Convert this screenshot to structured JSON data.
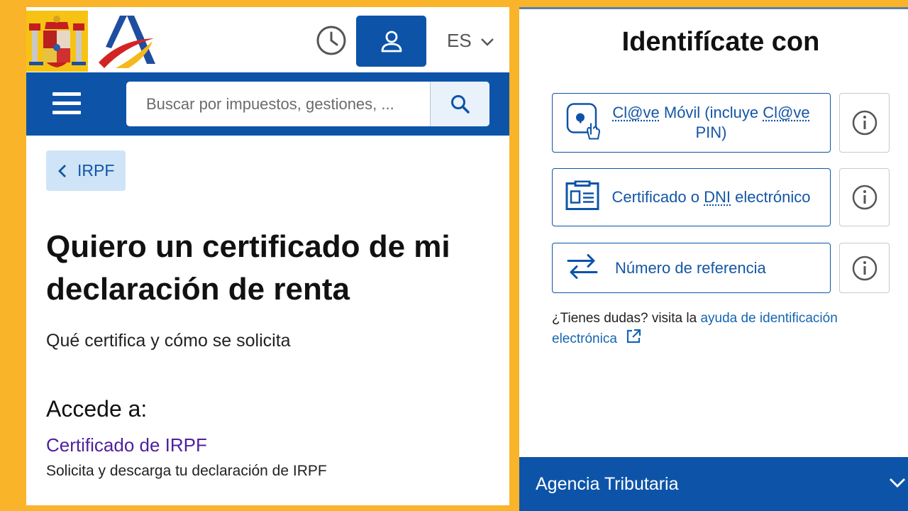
{
  "header": {
    "lang": "ES",
    "search_placeholder": "Buscar por impuestos, gestiones, ..."
  },
  "left": {
    "back_label": "IRPF",
    "title": "Quiero un certificado de mi declaración de renta",
    "subtitle": "Qué certifica y cómo se solicita",
    "accede": "Accede a:",
    "cert_link": "Certificado de IRPF",
    "cert_desc": "Solicita y descarga tu declaración de IRPF"
  },
  "right": {
    "title": "Identifícate con",
    "options": [
      {
        "label_a": "Cl@ve",
        "label_b": " Móvil (incluye ",
        "label_c": "Cl@ve",
        "label_d": " PIN)"
      },
      {
        "label_a": "Certificado o ",
        "label_b": "DNI",
        "label_c": " electrónico"
      },
      {
        "label": "Número de referencia"
      }
    ],
    "help_text": "¿Tienes dudas? visita la ",
    "help_link": "ayuda de identificación electrónica",
    "footer_label": "Agencia Tributaria"
  },
  "colors": {
    "brand_blue": "#0d54a8",
    "frame_yellow": "#f9b42a",
    "link_purple": "#4f1f9e"
  }
}
